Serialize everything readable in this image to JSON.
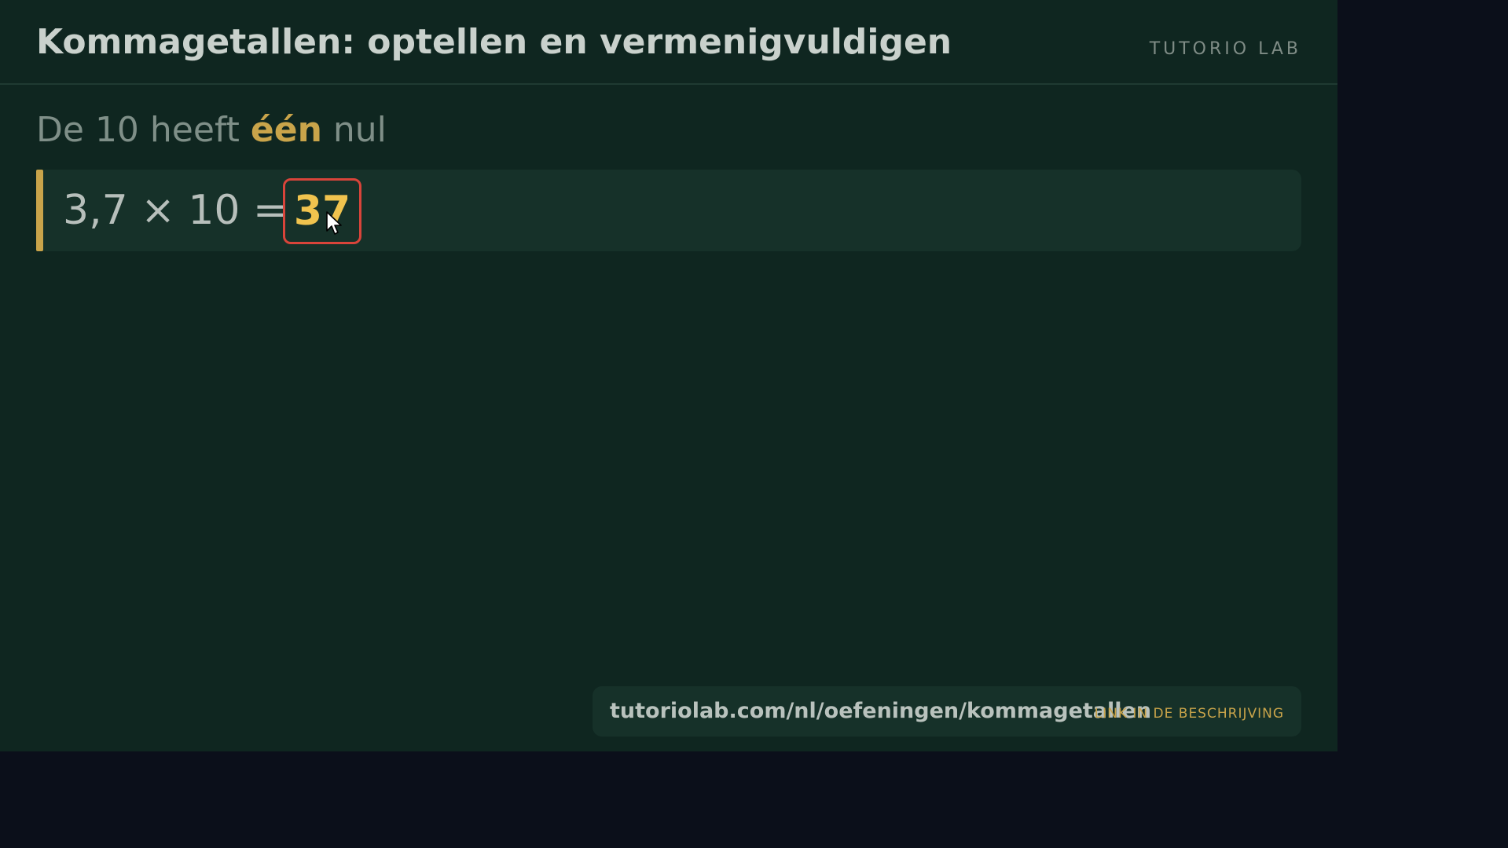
{
  "header": {
    "title": "Kommagetallen: optellen en vermenigvuldigen",
    "brand": "TUTORIO LAB"
  },
  "subtitle": {
    "prefix": "De 10 heeft ",
    "highlight": "één",
    "suffix": " nul"
  },
  "equation": {
    "expression": "3,7 × 10 =",
    "answer": "37"
  },
  "footer": {
    "url": "tutoriolab.com/nl/oefeningen/kommagetallen",
    "note": "LINK IN DE BESCHRIJVING"
  },
  "icons": {
    "cursor": "mouse-pointer-icon"
  },
  "colors": {
    "board": "#0f2620",
    "accent": "#c9a44a",
    "answer": "#f0c34e",
    "answer_border": "#d9443a",
    "outer": "#0b0f1a"
  }
}
